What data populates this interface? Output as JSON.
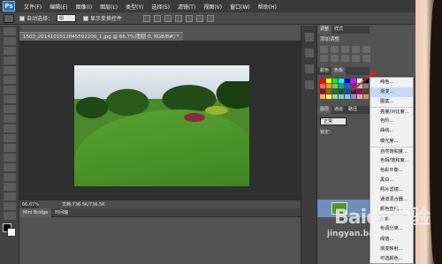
{
  "app": {
    "logo": "Ps",
    "menu": [
      "文件(F)",
      "编辑(E)",
      "图像(I)",
      "图层(L)",
      "类型(Y)",
      "选择(S)",
      "滤镜(T)",
      "视图(V)",
      "窗口(W)",
      "帮助(H)"
    ]
  },
  "options": {
    "auto_select_label": "自动选择：",
    "auto_select_value": "组",
    "show_transform_label": "显示变换控件"
  },
  "document": {
    "tab_title": "1503_2014101512845592200_1.jpg @ 66.7%(图层 0, RGB/8#) *",
    "zoom": "66.67%",
    "doc_info": "文档:736.5K/736.5K"
  },
  "bottom_tabs": [
    "Mini Bridge",
    "时间轴"
  ],
  "panels": {
    "adjust_tabs": [
      "调整",
      "样式"
    ],
    "adjust_title": "添加调整",
    "color_tabs": [
      "颜色",
      "色板"
    ],
    "layers_tabs": [
      "图层",
      "通道",
      "路径"
    ],
    "layer_mode": "正常",
    "lock_label": "锁定："
  },
  "context_menu": {
    "items": [
      "纯色...",
      "渐变...",
      "图案...",
      "亮度/对比度...",
      "色阶...",
      "曲线...",
      "曝光度...",
      "自然饱和度...",
      "色相/饱和度...",
      "色彩平衡...",
      "黑白...",
      "照片滤镜...",
      "通道混合器...",
      "颜色查找...",
      "反相",
      "色调分离...",
      "阈值...",
      "渐变映射...",
      "可选颜色..."
    ],
    "highlighted": "渐变..."
  },
  "watermark": {
    "line1": "Baidu经验",
    "line2": "jingyan.baidu.com"
  },
  "colors": {
    "accent_arrow": "#e02020",
    "highlight": "#c6daf6"
  }
}
